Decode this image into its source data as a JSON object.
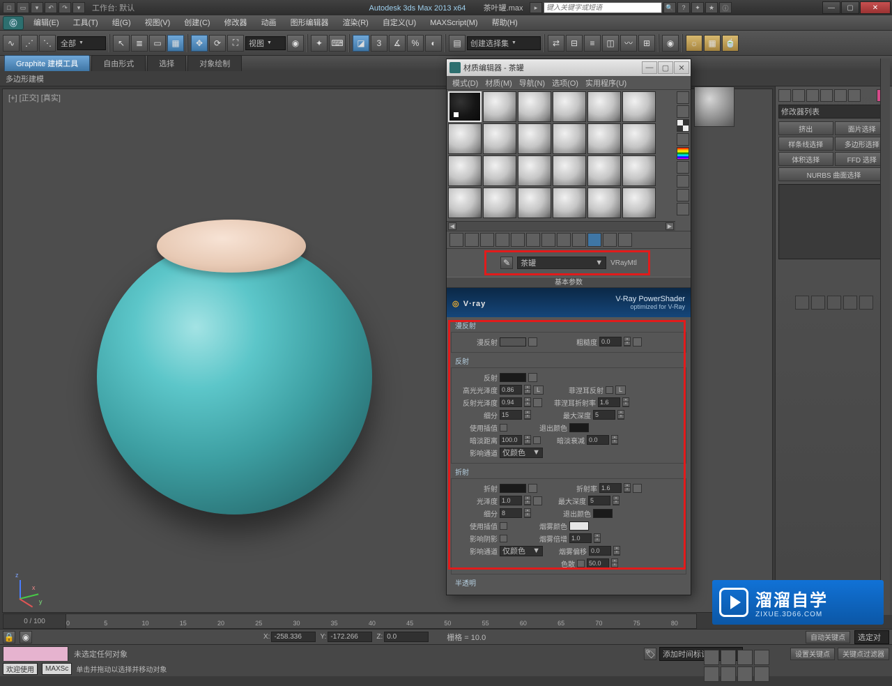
{
  "title": {
    "app": "Autodesk 3ds Max  2013 x64",
    "file": "茶叶罐.max",
    "workspace": "工作台: 默认"
  },
  "search": {
    "placeholder": "键入关键字或短语"
  },
  "menu": [
    "编辑(E)",
    "工具(T)",
    "组(G)",
    "视图(V)",
    "创建(C)",
    "修改器",
    "动画",
    "图形编辑器",
    "渲染(R)",
    "自定义(U)",
    "MAXScript(M)",
    "帮助(H)"
  ],
  "toolbar": {
    "filter": "全部",
    "view": "视图",
    "selset": "创建选择集"
  },
  "ribbon": {
    "tabs": [
      "Graphite 建模工具",
      "自由形式",
      "选择",
      "对象绘制"
    ],
    "sub": "多边形建模"
  },
  "viewport": {
    "label": "[+] [正交] [真实]"
  },
  "right": {
    "modlist": "修改器列表",
    "btns": [
      "挤出",
      "面片选择",
      "样条线选择",
      "多边形选择",
      "体积选择",
      "FFD 选择"
    ],
    "nurbs": "NURBS 曲面选择"
  },
  "medit": {
    "title": "材质编辑器 - 茶罐",
    "menu": [
      "模式(D)",
      "材质(M)",
      "导航(N)",
      "选项(O)",
      "实用程序(U)"
    ],
    "name": "茶罐",
    "type": "VRayMtl",
    "section": "基本参数",
    "vray": {
      "brand": "V·ray",
      "line1": "V-Ray PowerShader",
      "line2": "optimized for V-Ray"
    },
    "diffuse": {
      "title": "漫反射",
      "lbl": "漫反射",
      "rough_l": "粗糙度",
      "rough_v": "0.0"
    },
    "reflect": {
      "title": "反射",
      "lbl": "反射",
      "hg_l": "高光光泽度",
      "hg_v": "0.86",
      "rg_l": "反射光泽度",
      "rg_v": "0.94",
      "sub_l": "细分",
      "sub_v": "15",
      "int_l": "使用插值",
      "dim_l": "暗淡距离",
      "dim_v": "100.0",
      "ch_l": "影响通道",
      "ch_v": "仅颜色",
      "L": "L",
      "fres_l": "菲涅耳反射",
      "fior_l": "菲涅耳折射率",
      "fior_v": "1.6",
      "md_l": "最大深度",
      "md_v": "5",
      "exit_l": "退出颜色",
      "dimf_l": "暗淡衰减",
      "dimf_v": "0.0"
    },
    "refract": {
      "title": "折射",
      "lbl": "折射",
      "gl_l": "光泽度",
      "gl_v": "1.0",
      "sub_l": "细分",
      "sub_v": "8",
      "int_l": "使用插值",
      "sh_l": "影响阴影",
      "ch_l": "影响通道",
      "ch_v": "仅颜色",
      "ior_l": "折射率",
      "ior_v": "1.6",
      "md_l": "最大深度",
      "md_v": "5",
      "exit_l": "退出颜色",
      "fogc_l": "烟雾颜色",
      "fogm_l": "烟雾倍增",
      "fogm_v": "1.0",
      "fogb_l": "烟雾偏移",
      "fogb_v": "0.0",
      "disp_l": "色散",
      "disp_v": "50.0"
    },
    "trans": "半透明"
  },
  "timeline": {
    "pos": "0 / 100",
    "ticks": [
      "0",
      "5",
      "10",
      "15",
      "20",
      "25",
      "30",
      "35",
      "40",
      "45",
      "50",
      "55",
      "60",
      "65",
      "70",
      "75",
      "80"
    ]
  },
  "coords": {
    "x_l": "X:",
    "x": "-258.336",
    "y_l": "Y:",
    "y": "-172.266",
    "z_l": "Z:",
    "z": "0.0",
    "grid_l": "栅格 = 10.0"
  },
  "status": {
    "none": "未选定任何对象",
    "prompt": "单击并拖动以选择并移动对象",
    "welcome": "欢迎使用",
    "max": "MAXSc",
    "autokey": "自动关键点",
    "seld": "选定对",
    "setkey": "设置关键点",
    "filt": "关键点过滤器",
    "addtm": "添加时间标记"
  },
  "logo": {
    "t": "溜溜自学",
    "s": "ZIXUE.3D66.COM"
  }
}
